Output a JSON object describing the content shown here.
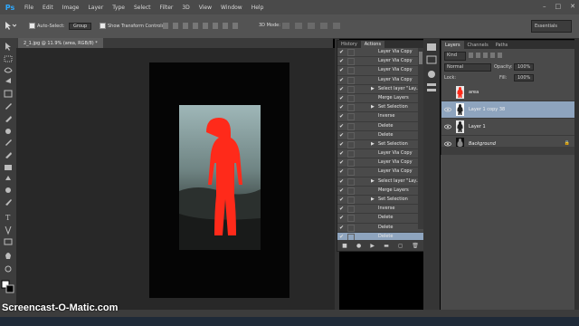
{
  "app": {
    "logo": "Ps",
    "window_controls": [
      "–",
      "□",
      "✕"
    ]
  },
  "menu": [
    "File",
    "Edit",
    "Image",
    "Layer",
    "Type",
    "Select",
    "Filter",
    "3D",
    "View",
    "Window",
    "Help"
  ],
  "options": {
    "auto_select_label": "Auto-Select:",
    "auto_select_value": "Group",
    "show_transform_label": "Show Transform Controls",
    "mode_3d_label": "3D Mode:",
    "workspace": "Essentials"
  },
  "document": {
    "tab_title": "2_1.jpg @ 11.9% (area, RGB/8) *"
  },
  "actions_panel": {
    "tabs": [
      "History",
      "Actions"
    ],
    "active_tab": "Actions",
    "rows": [
      {
        "label": "Layer Via Copy",
        "expand": false,
        "highlight": false
      },
      {
        "label": "Layer Via Copy",
        "expand": false,
        "highlight": false
      },
      {
        "label": "Layer Via Copy",
        "expand": false,
        "highlight": false
      },
      {
        "label": "Layer Via Copy",
        "expand": false,
        "highlight": false
      },
      {
        "label": "Select layer \"Lay...",
        "expand": true,
        "highlight": false
      },
      {
        "label": "Merge Layers",
        "expand": false,
        "highlight": false
      },
      {
        "label": "Set Selection",
        "expand": true,
        "highlight": false
      },
      {
        "label": "Inverse",
        "expand": false,
        "highlight": false
      },
      {
        "label": "Delete",
        "expand": false,
        "highlight": false
      },
      {
        "label": "Delete",
        "expand": false,
        "highlight": false
      },
      {
        "label": "Set Selection",
        "expand": true,
        "highlight": false
      },
      {
        "label": "Layer Via Copy",
        "expand": false,
        "highlight": false
      },
      {
        "label": "Layer Via Copy",
        "expand": false,
        "highlight": false
      },
      {
        "label": "Layer Via Copy",
        "expand": false,
        "highlight": false
      },
      {
        "label": "Select layer \"Lay...",
        "expand": true,
        "highlight": false
      },
      {
        "label": "Merge Layers",
        "expand": false,
        "highlight": false
      },
      {
        "label": "Set Selection",
        "expand": true,
        "highlight": false
      },
      {
        "label": "Inverse",
        "expand": false,
        "highlight": false
      },
      {
        "label": "Delete",
        "expand": false,
        "highlight": false
      },
      {
        "label": "Delete",
        "expand": false,
        "highlight": false
      },
      {
        "label": "Delete",
        "expand": false,
        "highlight": true
      }
    ],
    "footer_icons": [
      "stop",
      "record",
      "play",
      "new-set",
      "new-action",
      "delete"
    ]
  },
  "layers_panel": {
    "tabs": [
      "Layers",
      "Channels",
      "Paths"
    ],
    "active_tab": "Layers",
    "kind_label": "Kind",
    "blend_mode": "Normal",
    "opacity_label": "Opacity:",
    "opacity_value": "100%",
    "lock_label": "Lock:",
    "fill_label": "Fill:",
    "fill_value": "100%",
    "layers": [
      {
        "name": "area",
        "visible": false,
        "selected": false,
        "thumb_color": "#e8e8e8"
      },
      {
        "name": "Layer 1 copy 38",
        "visible": true,
        "selected": true,
        "thumb_color": "#ffffff"
      },
      {
        "name": "Layer 1",
        "visible": true,
        "selected": false,
        "thumb_color": "#e8e8e8"
      },
      {
        "name": "Background",
        "visible": true,
        "selected": false,
        "thumb_color": "#111111"
      }
    ]
  },
  "watermark": "Screencast-O-Matic.com",
  "colors": {
    "accent": "#2fa9ff",
    "selection": "#8ea4be",
    "silhouette": "#ff2a1a"
  }
}
